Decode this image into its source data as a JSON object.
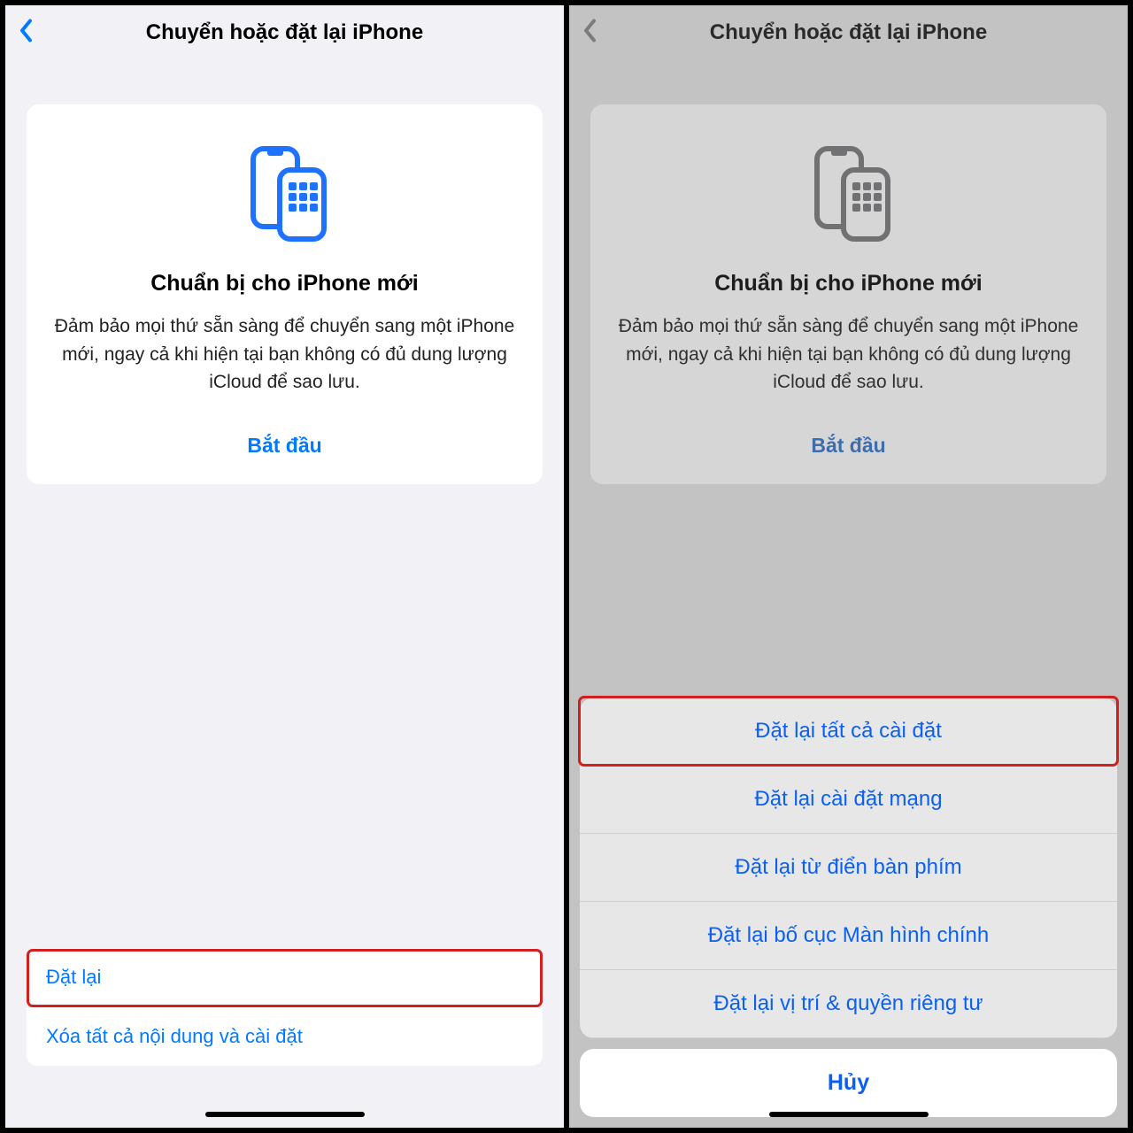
{
  "left": {
    "nav_title": "Chuyển hoặc đặt lại iPhone",
    "card": {
      "title": "Chuẩn bị cho iPhone mới",
      "description": "Đảm bảo mọi thứ sẵn sàng để chuyển sang một iPhone mới, ngay cả khi hiện tại bạn không có đủ dung lượng iCloud để sao lưu.",
      "cta": "Bắt đầu"
    },
    "list": [
      "Đặt lại",
      "Xóa tất cả nội dung và cài đặt"
    ]
  },
  "right": {
    "nav_title": "Chuyển hoặc đặt lại iPhone",
    "card": {
      "title": "Chuẩn bị cho iPhone mới",
      "description": "Đảm bảo mọi thứ sẵn sàng để chuyển sang một iPhone mới, ngay cả khi hiện tại bạn không có đủ dung lượng iCloud để sao lưu.",
      "cta": "Bắt đầu"
    },
    "sheet": {
      "options": [
        "Đặt lại tất cả cài đặt",
        "Đặt lại cài đặt mạng",
        "Đặt lại từ điển bàn phím",
        "Đặt lại bố cục Màn hình chính",
        "Đặt lại vị trí & quyền riêng tư"
      ],
      "cancel": "Hủy"
    }
  },
  "colors": {
    "accent": "#007aff",
    "highlight": "#d1201f"
  }
}
